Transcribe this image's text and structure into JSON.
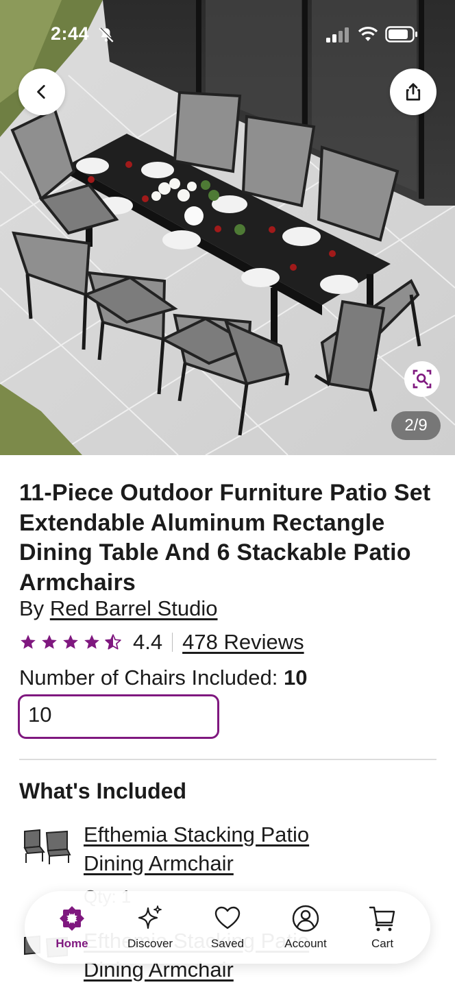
{
  "status_bar": {
    "time": "2:44",
    "icons": [
      "bell-slash-icon",
      "signal-icon",
      "wifi-icon",
      "battery-icon"
    ]
  },
  "gallery": {
    "counter": "2/9",
    "buttons": [
      "back-icon",
      "share-icon",
      "visual-search-icon"
    ]
  },
  "product": {
    "title": "11-Piece Outdoor Furniture Patio Set Extendable Aluminum Rectangle Dining Table And 6 Stackable Patio Armchairs",
    "by_prefix": "By",
    "brand": "Red Barrel Studio",
    "rating": "4.4",
    "rating_stars": 4.4,
    "reviews": "478 Reviews",
    "option_label": "Number of Chairs Included:",
    "option_value": "10",
    "option_selected": "10"
  },
  "included": {
    "title": "What's Included",
    "items": [
      {
        "name": "Efthemia Stacking Patio Dining Armchair",
        "qty": "Qty: 1"
      },
      {
        "name": "Efthemia Stacking Patio Dining Armchair",
        "qty": ""
      }
    ]
  },
  "nav": {
    "items": [
      {
        "label": "Home",
        "icon": "home-icon",
        "active": true
      },
      {
        "label": "Discover",
        "icon": "sparkle-icon"
      },
      {
        "label": "Saved",
        "icon": "heart-icon"
      },
      {
        "label": "Account",
        "icon": "account-icon"
      },
      {
        "label": "Cart",
        "icon": "cart-icon"
      }
    ]
  },
  "colors": {
    "brand_purple": "#7f187f",
    "text": "#1b1b1b"
  }
}
